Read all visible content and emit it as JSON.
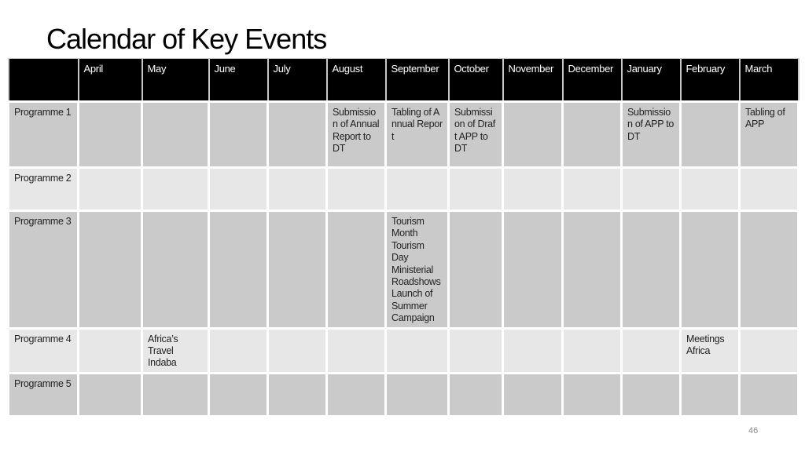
{
  "title": "Calendar of Key Events",
  "table": {
    "corner": "",
    "months": [
      "April",
      "May",
      "June",
      "July",
      "August",
      "September",
      "October",
      "November",
      "December",
      "January",
      "February",
      "March"
    ],
    "rows": [
      {
        "label": "Programme 1",
        "cells": [
          "",
          "",
          "",
          "",
          "Submission of Annual Report to DT",
          "Tabling of Annual Report",
          "Submission of Draft APP to DT",
          "",
          "",
          "Submission of APP to DT",
          "",
          "Tabling of APP"
        ]
      },
      {
        "label": "Programme 2",
        "cells": [
          "",
          "",
          "",
          "",
          "",
          "",
          "",
          "",
          "",
          "",
          "",
          ""
        ]
      },
      {
        "label": "Programme 3",
        "cells": [
          "",
          "",
          "",
          "",
          "",
          "Tourism Month Tourism Day Ministerial Roadshows Launch of Summer Campaign",
          "",
          "",
          "",
          "",
          "",
          ""
        ]
      },
      {
        "label": "Programme 4",
        "cells": [
          "",
          "Africa’s Travel Indaba",
          "",
          "",
          "",
          "",
          "",
          "",
          "",
          "",
          "Meetings Africa",
          ""
        ]
      },
      {
        "label": "Programme 5",
        "cells": [
          "",
          "",
          "",
          "",
          "",
          "",
          "",
          "",
          "",
          "",
          "",
          ""
        ]
      }
    ]
  },
  "colors": {
    "header_bg": "#000000",
    "row_dark": "#cacaca",
    "row_light": "#e7e7e7"
  },
  "page_number": "46"
}
